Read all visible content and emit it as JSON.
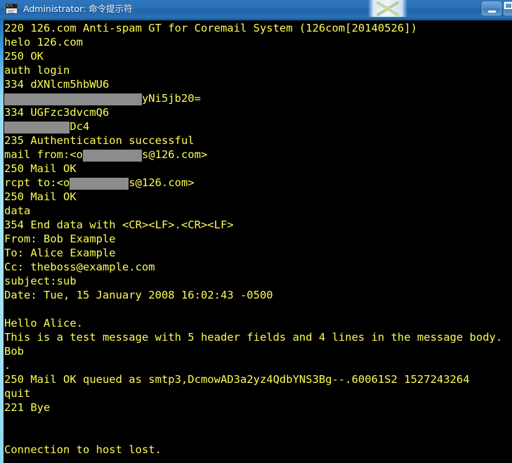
{
  "window": {
    "title": "Administrator: 命令提示符",
    "icon": "console-cmd-icon",
    "icon_label": "C:\\",
    "titlebar_color": "#2a6fb5",
    "frame_color": "#a2e0f6",
    "buttons": [
      {
        "name": "minimize",
        "glyph": "minimize-glyph"
      },
      {
        "name": "maximize",
        "glyph": "maximize-glyph"
      }
    ]
  },
  "console": {
    "background": "#000000",
    "foreground": "#fcfc54",
    "redaction_color": "#8c8c8c",
    "lines": [
      {
        "id": "l01",
        "text": "220 126.com Anti-spam GT for Coremail System (126com[20140526])"
      },
      {
        "id": "l02",
        "text": "helo 126.com"
      },
      {
        "id": "l03",
        "text": "250 OK"
      },
      {
        "id": "l04",
        "text": "auth login"
      },
      {
        "id": "l05",
        "text": "334 dXNlcm5hbWU6"
      },
      {
        "id": "l06",
        "redacted_prefix": "                     ",
        "text": "yNi5jb20="
      },
      {
        "id": "l07",
        "text": "334 UGFzc3dvcmQ6"
      },
      {
        "id": "l08",
        "redacted_prefix": "          ",
        "text": "Dc4"
      },
      {
        "id": "l09",
        "text": "235 Authentication successful"
      },
      {
        "id": "l10",
        "prefix": "mail from:<o",
        "redacted_mid": "         ",
        "suffix": "s@126.com>"
      },
      {
        "id": "l11",
        "text": "250 Mail OK"
      },
      {
        "id": "l12",
        "prefix": "rcpt to:<o",
        "redacted_mid": "         ",
        "suffix": "s@126.com>"
      },
      {
        "id": "l13",
        "text": "250 Mail OK"
      },
      {
        "id": "l14",
        "text": "data"
      },
      {
        "id": "l15",
        "text": "354 End data with <CR><LF>.<CR><LF>"
      },
      {
        "id": "l16",
        "text": "From: Bob Example"
      },
      {
        "id": "l17",
        "text": "To: Alice Example"
      },
      {
        "id": "l18",
        "text": "Cc: theboss@example.com"
      },
      {
        "id": "l19",
        "text": "subject:sub"
      },
      {
        "id": "l20",
        "text": "Date: Tue, 15 January 2008 16:02:43 -0500"
      },
      {
        "id": "l21",
        "text": ""
      },
      {
        "id": "l22",
        "text": "Hello Alice."
      },
      {
        "id": "l23",
        "text": "This is a test message with 5 header fields and 4 lines in the message body."
      },
      {
        "id": "l24",
        "text": "Bob"
      },
      {
        "id": "l25",
        "text": "."
      },
      {
        "id": "l26",
        "text": "250 Mail OK queued as smtp3,DcmowAD3a2yz4QdbYNS3Bg--.60061S2 1527243264"
      },
      {
        "id": "l27",
        "text": "quit"
      },
      {
        "id": "l28",
        "text": "221 Bye"
      },
      {
        "id": "l29",
        "text": ""
      },
      {
        "id": "l30",
        "text": ""
      },
      {
        "id": "l31",
        "text": "Connection to host lost."
      }
    ]
  }
}
